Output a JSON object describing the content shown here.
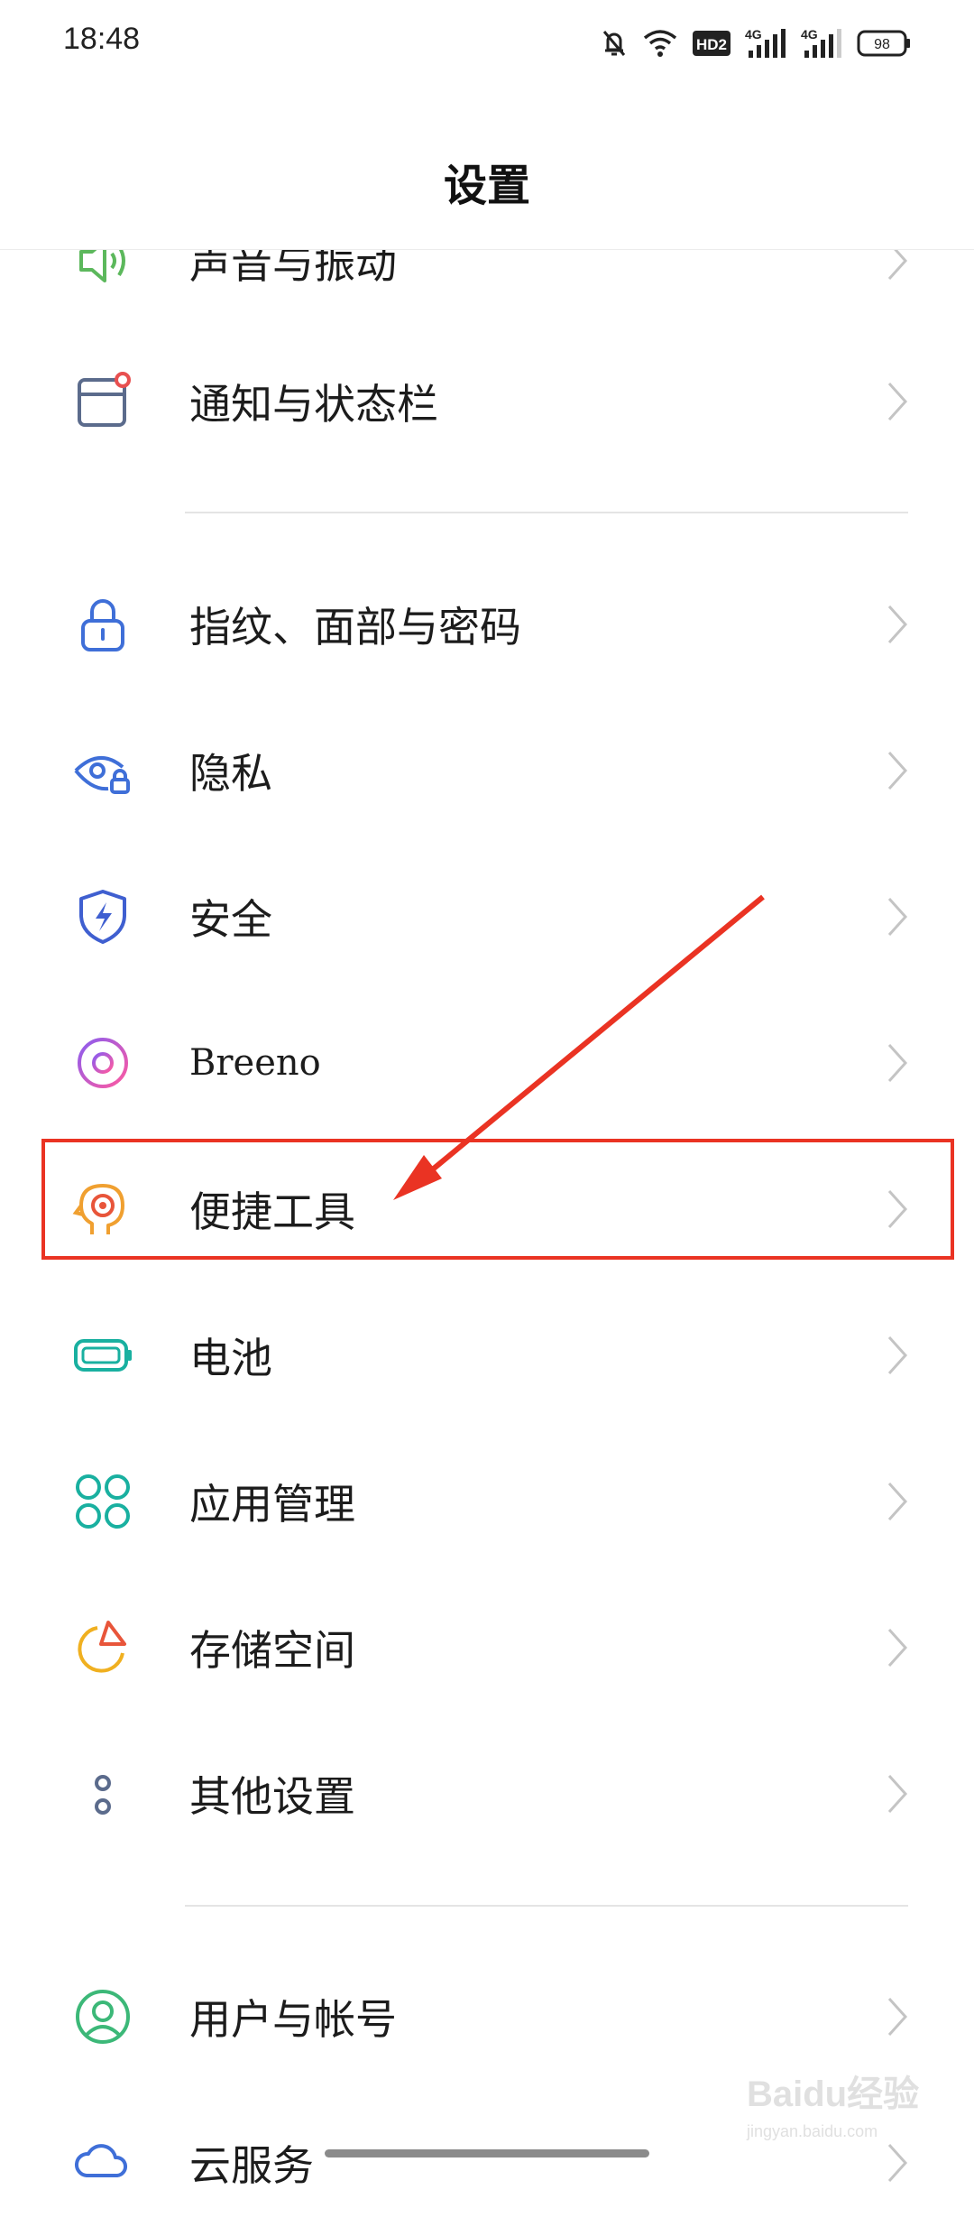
{
  "status_bar": {
    "time": "18:48",
    "icons": [
      "bell-off-icon",
      "wifi-icon",
      "hd-icon",
      "signal-4g-icon",
      "signal-4g-icon"
    ],
    "hd_label": "HD2",
    "net_label_1": "4G",
    "net_label_2": "4G",
    "battery": "98"
  },
  "header": {
    "title": "设置"
  },
  "items": [
    {
      "label": "声音与振动",
      "icon": "speaker-icon",
      "color": "#5cb85c"
    },
    {
      "label": "通知与状态栏",
      "icon": "notification-icon",
      "color": "#5b6b8c"
    },
    {
      "label": "指纹、面部与密码",
      "icon": "lock-icon",
      "color": "#3f6fd8"
    },
    {
      "label": "隐私",
      "icon": "privacy-eye-icon",
      "color": "#3f6fd8"
    },
    {
      "label": "安全",
      "icon": "shield-icon",
      "color": "#3f5fd0"
    },
    {
      "label": "Breeno",
      "icon": "breeno-icon",
      "color": "#b060d0"
    },
    {
      "label": "便捷工具",
      "icon": "tools-head-icon",
      "color": "#f0a030"
    },
    {
      "label": "电池",
      "icon": "battery-icon",
      "color": "#19b0a0"
    },
    {
      "label": "应用管理",
      "icon": "apps-icon",
      "color": "#19b0a0"
    },
    {
      "label": "存储空间",
      "icon": "storage-pie-icon",
      "color": "#f0b020"
    },
    {
      "label": "其他设置",
      "icon": "more-dots-icon",
      "color": "#5b6b8c"
    },
    {
      "label": "用户与帐号",
      "icon": "user-icon",
      "color": "#3cb878"
    },
    {
      "label": "云服务",
      "icon": "cloud-icon",
      "color": "#3f6fd8"
    }
  ],
  "annotation": {
    "highlight_color": "#ea3323"
  },
  "watermark": {
    "text": "Baidu经验",
    "sub": "jingyan.baidu.com"
  }
}
